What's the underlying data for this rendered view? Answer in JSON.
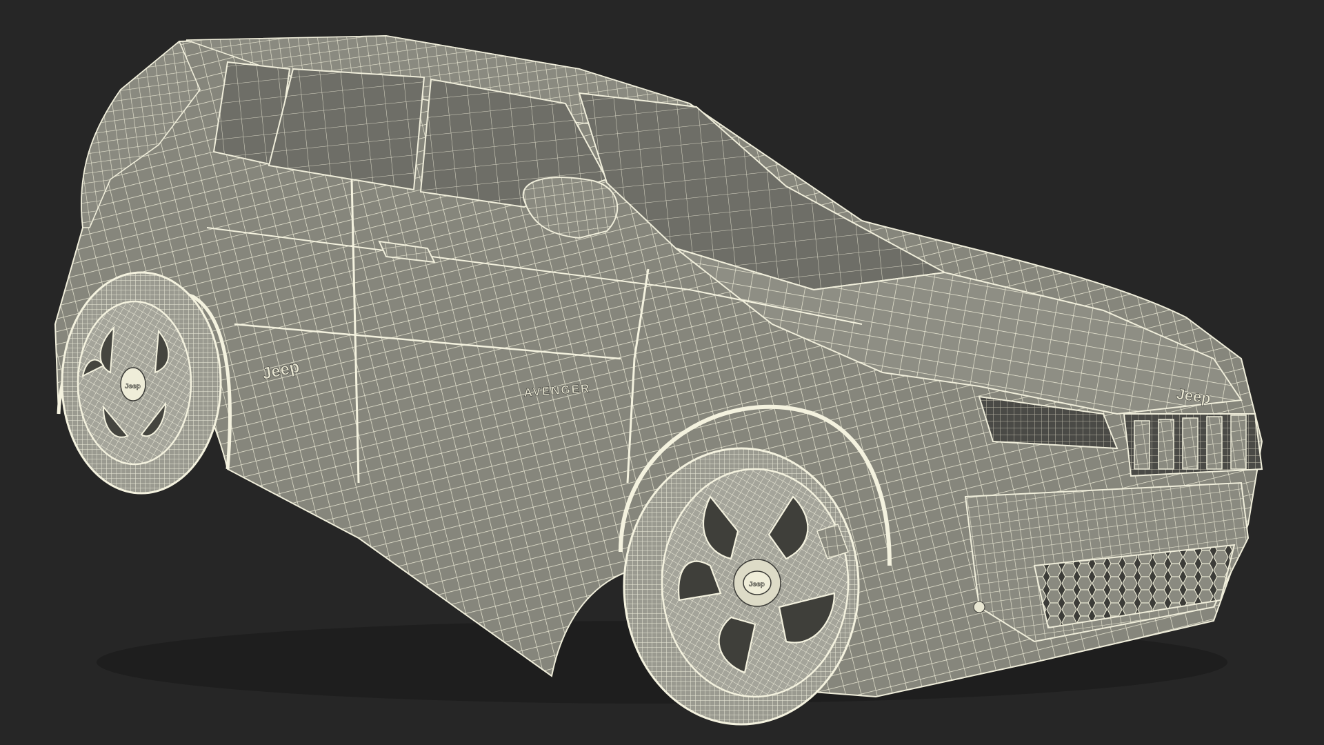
{
  "scene": {
    "subject": "wireframe-suv",
    "background_color": "#262626",
    "wire_color": "#e8e6d2",
    "shadow_color": "#7e7e74",
    "glass_color": "#6f6f68"
  },
  "badges": {
    "brand_side": "Jeep",
    "model_side": "AVENGER",
    "brand_hood": "Jeep",
    "brand_wheel_front": "Jeep",
    "brand_wheel_rear": "Jeep"
  }
}
